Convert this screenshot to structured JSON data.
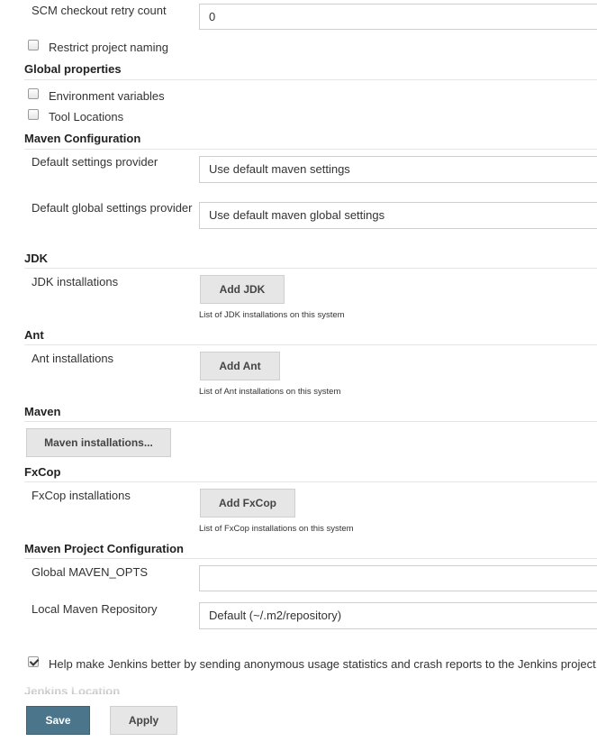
{
  "scm": {
    "label": "SCM checkout retry count",
    "value": "0"
  },
  "restrict_naming": {
    "label": "Restrict project naming",
    "checked": false
  },
  "global_properties": {
    "title": "Global properties",
    "env_vars": {
      "label": "Environment variables",
      "checked": false
    },
    "tool_locations": {
      "label": "Tool Locations",
      "checked": false
    }
  },
  "maven_config": {
    "title": "Maven Configuration",
    "settings_label": "Default settings provider",
    "settings_value": "Use default maven settings",
    "global_settings_label": "Default global settings provider",
    "global_settings_value": "Use default maven global settings"
  },
  "jdk": {
    "title": "JDK",
    "label": "JDK installations",
    "button": "Add JDK",
    "hint": "List of JDK installations on this system"
  },
  "ant": {
    "title": "Ant",
    "label": "Ant installations",
    "button": "Add Ant",
    "hint": "List of Ant installations on this system"
  },
  "maven": {
    "title": "Maven",
    "button": "Maven installations..."
  },
  "fxcop": {
    "title": "FxCop",
    "label": "FxCop installations",
    "button": "Add FxCop",
    "hint": "List of FxCop installations on this system"
  },
  "maven_project": {
    "title": "Maven Project Configuration",
    "opts_label": "Global MAVEN_OPTS",
    "opts_value": "",
    "repo_label": "Local Maven Repository",
    "repo_value": "Default (~/.m2/repository)"
  },
  "usage_stats": {
    "label": "Help make Jenkins better by sending anonymous usage statistics and crash reports to the Jenkins project.",
    "checked": true
  },
  "next_section": {
    "title": "Jenkins Location"
  },
  "actions": {
    "save": "Save",
    "apply": "Apply"
  }
}
